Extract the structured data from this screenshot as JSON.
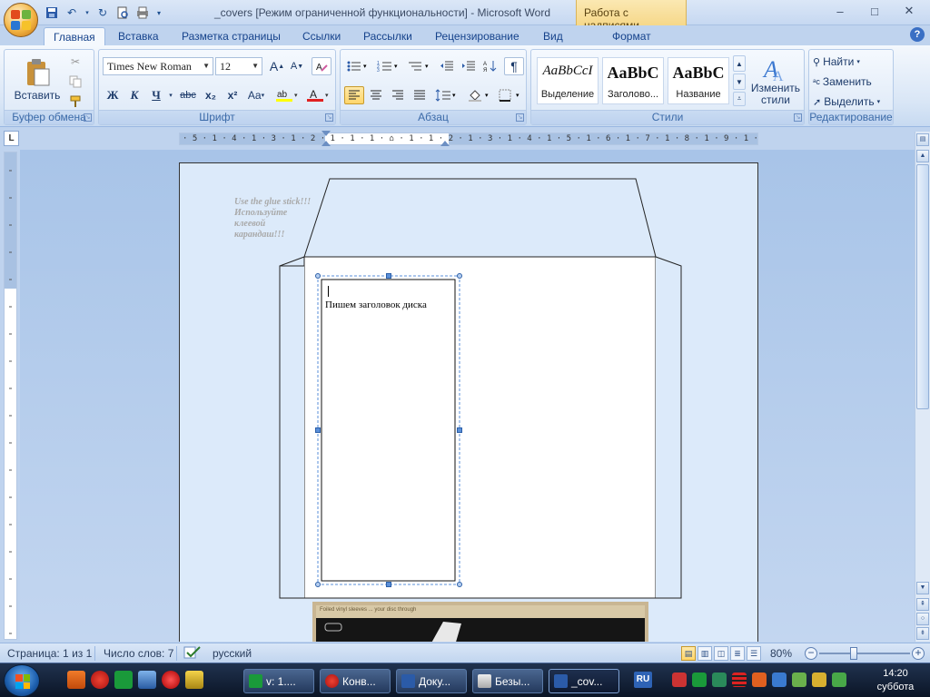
{
  "window": {
    "title": "_covers [Режим ограниченной функциональности] - Microsoft Word",
    "context_tab_title": "Работа с надписями",
    "minimize": "–",
    "maximize": "□",
    "close": "✕"
  },
  "tabs": [
    {
      "label": "Главная"
    },
    {
      "label": "Вставка"
    },
    {
      "label": "Разметка страницы"
    },
    {
      "label": "Ссылки"
    },
    {
      "label": "Рассылки"
    },
    {
      "label": "Рецензирование"
    },
    {
      "label": "Вид"
    },
    {
      "label": "Формат"
    }
  ],
  "ribbon": {
    "clipboard": {
      "label": "Буфер обмена",
      "paste": "Вставить"
    },
    "font": {
      "label": "Шрифт",
      "family": "Times New Roman",
      "size": "12",
      "bold": "Ж",
      "italic": "К",
      "underline": "Ч",
      "strike": "abc",
      "subscript": "x₂",
      "superscript": "x²",
      "change_case": "Aa",
      "grow": "A",
      "shrink": "A"
    },
    "paragraph": {
      "label": "Абзац",
      "show_marks": "¶"
    },
    "styles": {
      "label": "Стили",
      "items": [
        {
          "sample": "AaBbCcI",
          "name": "Выделение"
        },
        {
          "sample": "AaBbC",
          "name": "Заголово..."
        },
        {
          "sample": "AaBbC",
          "name": "Название"
        }
      ],
      "change_styles": "Изменить стили"
    },
    "editing": {
      "label": "Редактирование",
      "find": "Найти",
      "replace": "Заменить",
      "select": "Выделить"
    }
  },
  "ruler": {
    "tab_selector": "L",
    "horizontal": "· 5 · 1 · 4 · 1 · 3 · 1 · 2 · 1 · 1 · 1 · ⌂ · 1 · 1 · 2 · 1 · 3 · 1 · 4 · 1 · 5 · 1 · 6 · 1 · 7 · 1 · 8 · 1 · 9 · 1 · 10 · 1 · 11 · 1 · 12 · 1 · 13 · 1 · 14 · 1 · 15 ·"
  },
  "document": {
    "glue_note": [
      "Use the glue stick!!!",
      "Используйте",
      "клеевой",
      "карандаш!!!"
    ],
    "textbox_text": "Пишем заголовок диска",
    "photo_caption": "Foiled vinyl sleeves ... your disc through"
  },
  "status": {
    "page": "Страница: 1 из 1",
    "words": "Число слов: 7",
    "language": "русский",
    "zoom": "80%"
  },
  "taskbar": {
    "tasks": [
      {
        "label": "v: 1...."
      },
      {
        "label": "Конв..."
      },
      {
        "label": "Доку..."
      },
      {
        "label": "Безы..."
      },
      {
        "label": "_cov..."
      }
    ],
    "lang": "RU",
    "time": "14:20",
    "day": "суббота"
  },
  "colors": {
    "accent": "#15428b",
    "ribbon_bg": "#dce8f7",
    "context_tab": "#f6d88a",
    "page_bg": "#dceafa"
  }
}
